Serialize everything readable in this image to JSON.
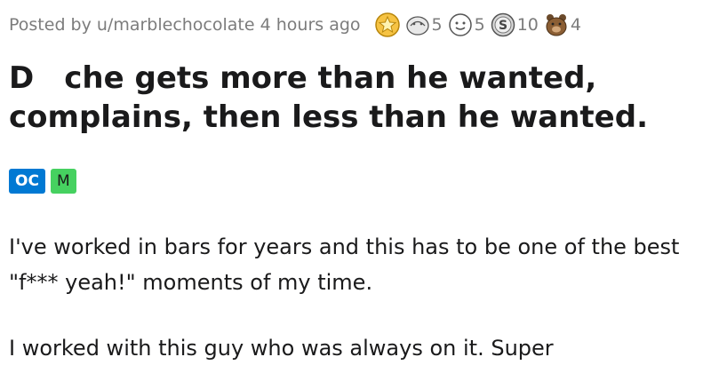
{
  "post": {
    "meta": "Posted by u/marblechocolate 4 hours ago",
    "awards": [
      {
        "icon": "gold-star-award-icon",
        "count": ""
      },
      {
        "icon": "hugz-award-icon",
        "count": "5"
      },
      {
        "icon": "wholesome-award-icon",
        "count": "5"
      },
      {
        "icon": "silver-coin-award-icon",
        "count": "10"
      },
      {
        "icon": "bear-award-icon",
        "count": "4"
      }
    ],
    "title_part1": "D",
    "title_part2": "che gets more than he wanted, complains, then less than he wanted.",
    "flairs": {
      "oc": "OC",
      "m": "M"
    },
    "paragraphs": [
      "I've worked in bars for years and this has to be one of the best \"f*** yeah!\" moments of my time.",
      "I worked with this guy who was always on it. Super"
    ]
  },
  "colors": {
    "oc_flair": "#0079d3",
    "m_flair": "#46d160",
    "meta_text": "#7c7c7c"
  }
}
